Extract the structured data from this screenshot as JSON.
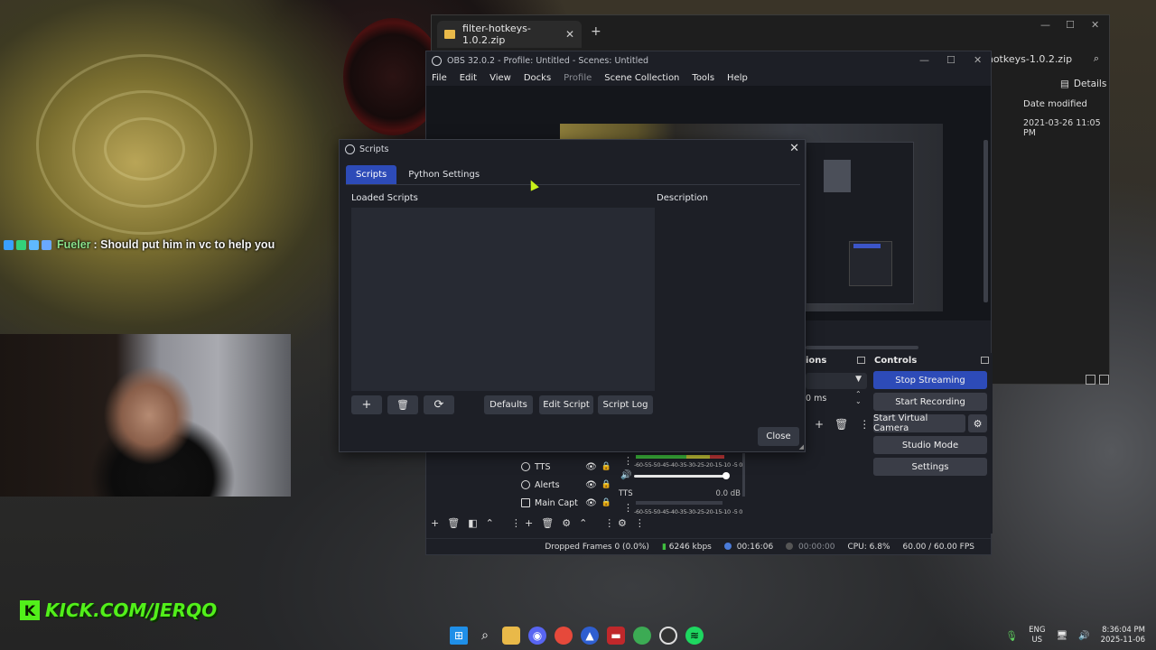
{
  "chat": {
    "user": "Fueler",
    "message": ": Should put him in vc to help you"
  },
  "overlay": {
    "kick_text": "KICK.COM/JERQO",
    "kick_logo": "K"
  },
  "explorer": {
    "tab_title": "filter-hotkeys-1.0.2.zip",
    "search_text": "filter-hotkeys-1.0.2.zip",
    "details_label": "Details",
    "column_header": "Date modified",
    "row_date": "2021-03-26 11:05 PM"
  },
  "obs": {
    "title": "OBS 32.0.2 - Profile: Untitled - Scenes: Untitled",
    "menu": [
      "File",
      "Edit",
      "View",
      "Docks",
      "Profile",
      "Scene Collection",
      "Tools",
      "Help"
    ],
    "transitions_header": "ions",
    "transition_duration": "0 ms",
    "controls": {
      "header": "Controls",
      "stop_streaming": "Stop Streaming",
      "start_recording": "Start Recording",
      "start_virtual_camera": "Start Virtual Camera",
      "studio_mode": "Studio Mode",
      "settings": "Settings"
    },
    "sources": [
      {
        "name": "TTS",
        "icon": "globe-icon"
      },
      {
        "name": "Alerts",
        "icon": "globe-icon"
      },
      {
        "name": "Main Capt",
        "icon": "monitor-icon"
      }
    ],
    "mixer": {
      "track_label": "TTS",
      "track_db": "0.0 dB",
      "scale": "-60-55-50-45-40-35-30-25-20-15-10 -5  0"
    },
    "status": {
      "dropped_frames": "Dropped Frames 0 (0.0%)",
      "bitrate": "6246 kbps",
      "stream_time": "00:16:06",
      "record_time": "00:00:00",
      "cpu": "CPU: 6.8%",
      "fps": "60.00 / 60.00 FPS"
    }
  },
  "scripts_dialog": {
    "title": "Scripts",
    "tabs": [
      "Scripts",
      "Python Settings"
    ],
    "active_tab": "Scripts",
    "loaded_scripts_label": "Loaded Scripts",
    "description_label": "Description",
    "defaults_label": "Defaults",
    "edit_script_label": "Edit Script",
    "script_log_label": "Script Log",
    "close_label": "Close",
    "loaded_scripts": []
  },
  "taskbar": {
    "lang_top": "ENG",
    "lang_bottom": "US",
    "time": "8:36:04 PM",
    "date": "2025-11-06"
  },
  "colors": {
    "accent": "#2d4bb8",
    "kick_green": "#52f01a",
    "chat_user": "#8be28b"
  }
}
